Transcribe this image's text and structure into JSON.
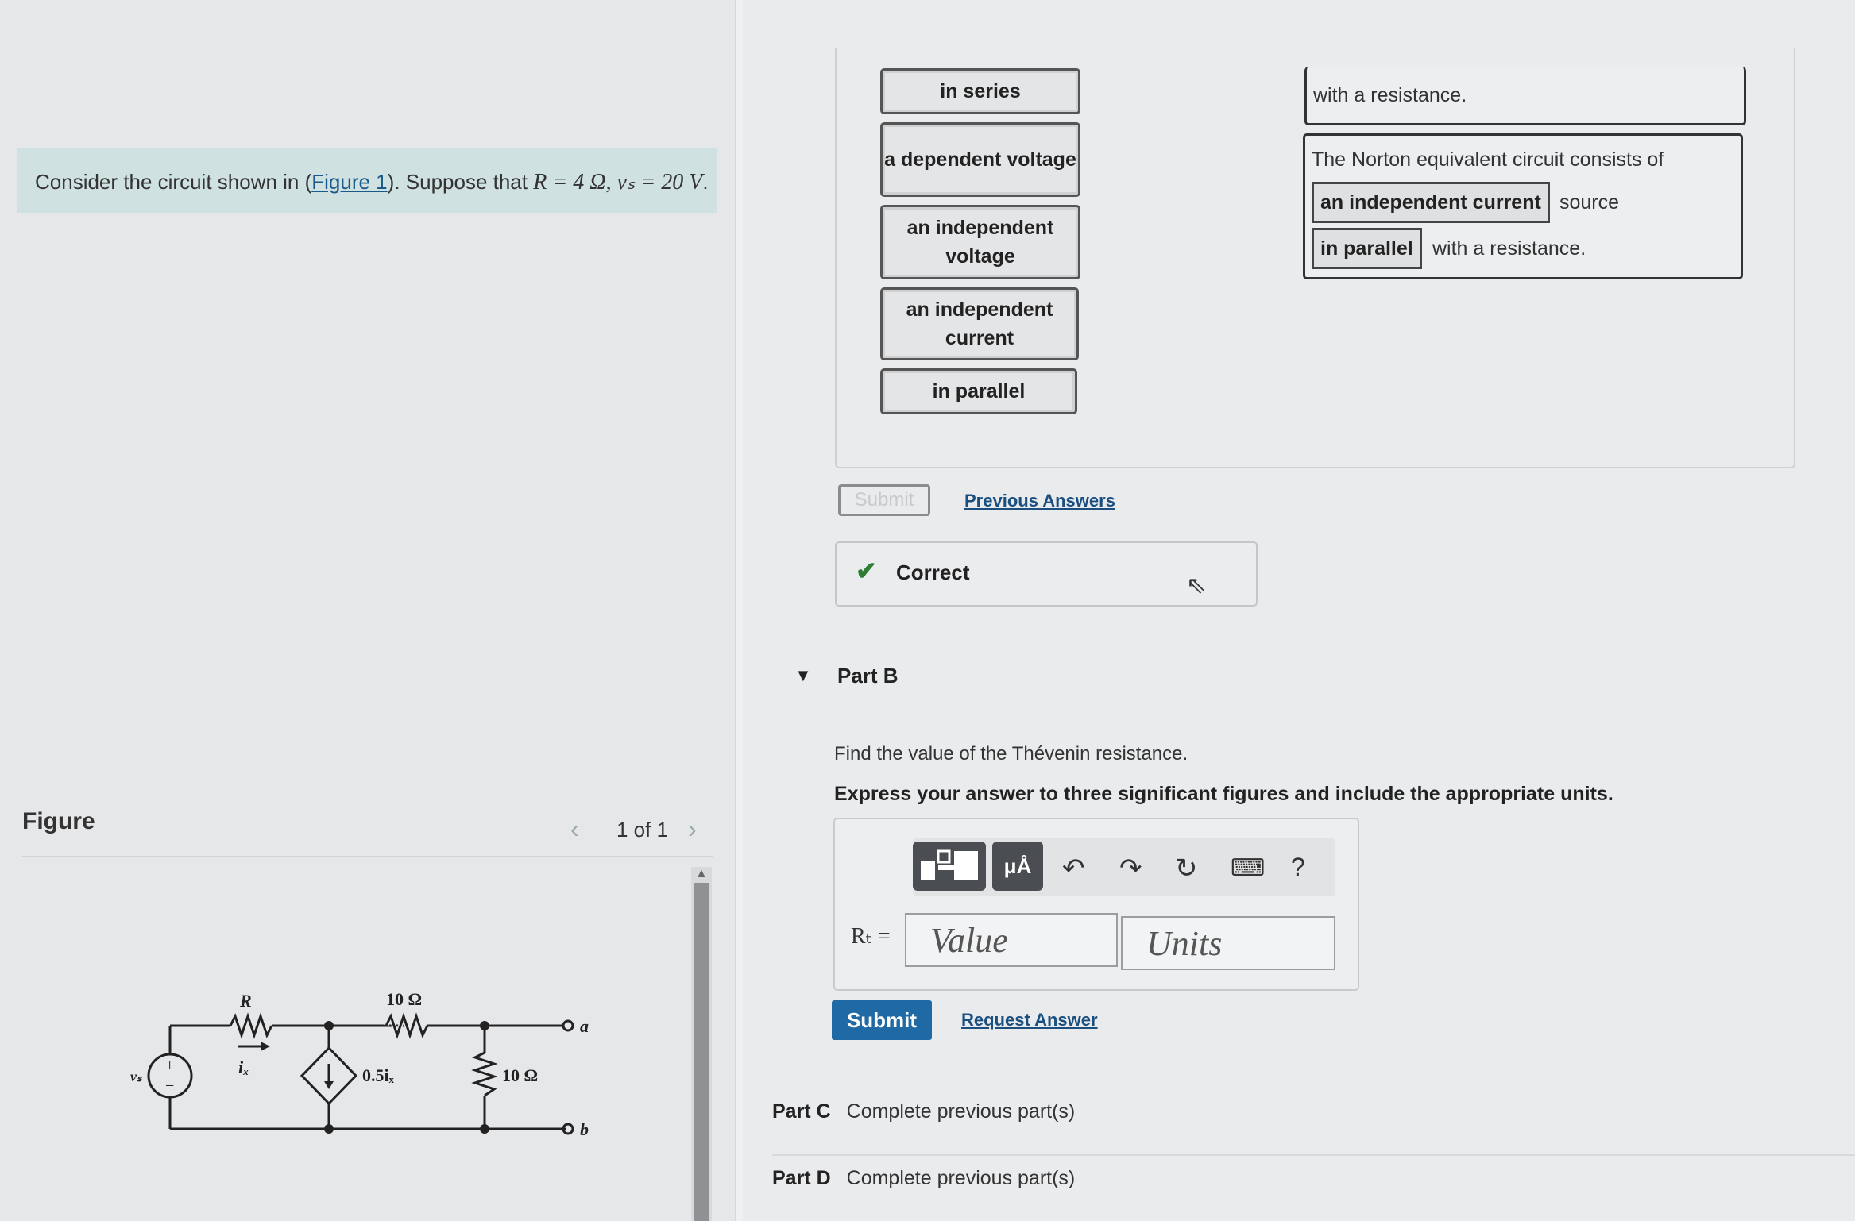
{
  "problem": {
    "prefix": "Consider the circuit shown in (",
    "figure_link": "Figure 1",
    "suffix": "). Suppose that ",
    "math": "R = 4 Ω, vₛ = 20 V",
    "end": "."
  },
  "figure": {
    "label": "Figure",
    "count": "1 of 1",
    "circuit": {
      "R_label": "R",
      "ix_label": "iₓ",
      "r1_label": "10 Ω",
      "source_label": "0.5iₓ",
      "r2_label": "10 Ω",
      "vs_label": "vₛ",
      "node_a": "a",
      "node_b": "b",
      "plus": "+",
      "minus": "−"
    }
  },
  "drag_options": [
    "in series",
    "a dependent voltage",
    "an independent voltage",
    "an independent current",
    "in parallel"
  ],
  "targets": {
    "top_text": "with a resistance.",
    "norton_intro": "The Norton equivalent circuit consists of",
    "norton_source_choice": "an independent current",
    "norton_source_word": "source",
    "norton_conn_choice": "in parallel",
    "norton_tail": "with a resistance."
  },
  "part_a": {
    "submit_label": "Submit",
    "previous_answers": "Previous Answers",
    "feedback": "Correct"
  },
  "part_b": {
    "title": "Part B",
    "question": "Find the value of the Thévenin resistance.",
    "instruction": "Express your answer to three significant figures and include the appropriate units.",
    "variable": "Rₜ =",
    "value_placeholder": "Value",
    "units_placeholder": "Units",
    "units_button": "μÅ",
    "help": "?",
    "submit_label": "Submit",
    "request_answer": "Request Answer"
  },
  "parts": [
    {
      "label": "Part C",
      "status": "Complete previous part(s)"
    },
    {
      "label": "Part D",
      "status": "Complete previous part(s)"
    }
  ]
}
